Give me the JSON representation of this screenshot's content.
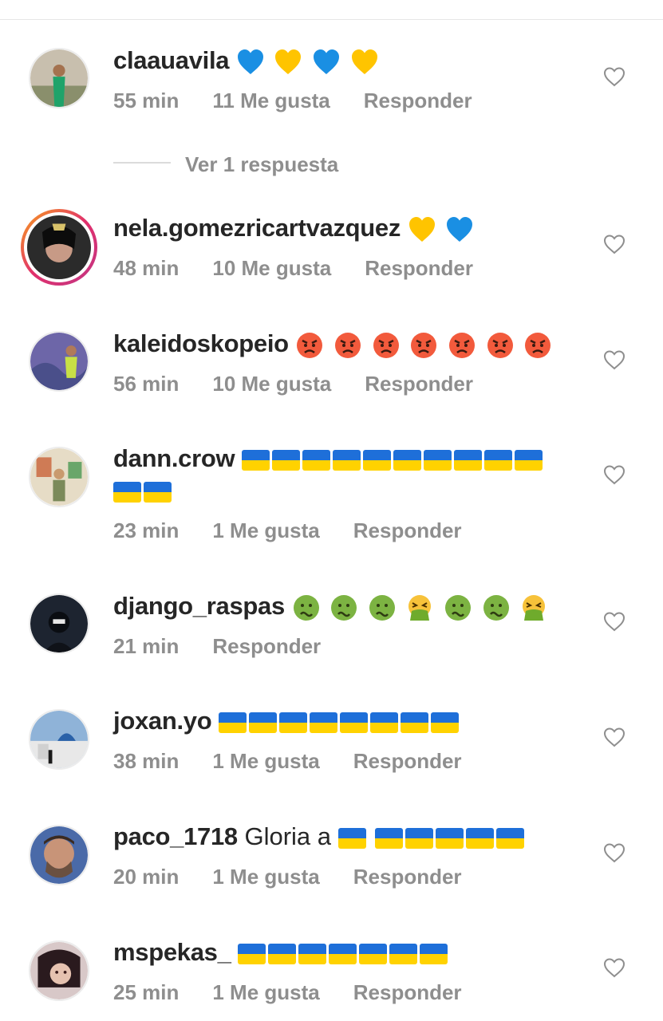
{
  "comments": [
    {
      "user": "claauavila",
      "text": "",
      "emoji": [
        "blue-heart",
        "yellow-heart",
        "blue-heart",
        "yellow-heart"
      ],
      "time": "55 min",
      "likes": "11 Me gusta",
      "reply": "Responder"
    },
    {
      "user": "nela.gomezricartvazquez",
      "text": "",
      "emoji": [
        "yellow-heart",
        "blue-heart"
      ],
      "time": "48 min",
      "likes": "10 Me gusta",
      "reply": "Responder"
    },
    {
      "user": "kaleidoskopeio",
      "text": "",
      "emoji": [
        "angry-face",
        "angry-face",
        "angry-face",
        "angry-face",
        "angry-face",
        "angry-face",
        "angry-face"
      ],
      "time": "56 min",
      "likes": "10 Me gusta",
      "reply": "Responder"
    },
    {
      "user": "dann.crow",
      "text": "",
      "emoji": [
        "ukraine-flag",
        "ukraine-flag",
        "ukraine-flag",
        "ukraine-flag",
        "ukraine-flag",
        "ukraine-flag",
        "ukraine-flag",
        "ukraine-flag",
        "ukraine-flag",
        "ukraine-flag",
        "ukraine-flag",
        "ukraine-flag"
      ],
      "time": "23 min",
      "likes": "1 Me gusta",
      "reply": "Responder"
    },
    {
      "user": "django_raspas",
      "text": "",
      "emoji": [
        "nauseated-face",
        "nauseated-face",
        "nauseated-face",
        "vomiting-face",
        "nauseated-face",
        "nauseated-face",
        "vomiting-face"
      ],
      "time": "21 min",
      "likes": "",
      "reply": "Responder"
    },
    {
      "user": "joxan.yo",
      "text": "",
      "emoji": [
        "ukraine-flag",
        "ukraine-flag",
        "ukraine-flag",
        "ukraine-flag",
        "ukraine-flag",
        "ukraine-flag",
        "ukraine-flag",
        "ukraine-flag"
      ],
      "time": "38 min",
      "likes": "1 Me gusta",
      "reply": "Responder"
    },
    {
      "user": "paco_1718",
      "text": "Gloria a",
      "emoji": [
        "ukraine-flag",
        "ukraine-flag",
        "ukraine-flag",
        "ukraine-flag",
        "ukraine-flag",
        "ukraine-flag"
      ],
      "time": "20 min",
      "likes": "1 Me gusta",
      "reply": "Responder"
    },
    {
      "user": "mspekas_",
      "text": "",
      "emoji": [
        "ukraine-flag",
        "ukraine-flag",
        "ukraine-flag",
        "ukraine-flag",
        "ukraine-flag",
        "ukraine-flag",
        "ukraine-flag"
      ],
      "time": "25 min",
      "likes": "1 Me gusta",
      "reply": "Responder"
    }
  ],
  "view_replies_label": "Ver 1 respuesta",
  "colors": {
    "text": "#262626",
    "muted": "#8e8e8e",
    "divider": "#dbdbdb",
    "flag_blue": "#1e6fd9",
    "flag_yellow": "#ffd200"
  }
}
